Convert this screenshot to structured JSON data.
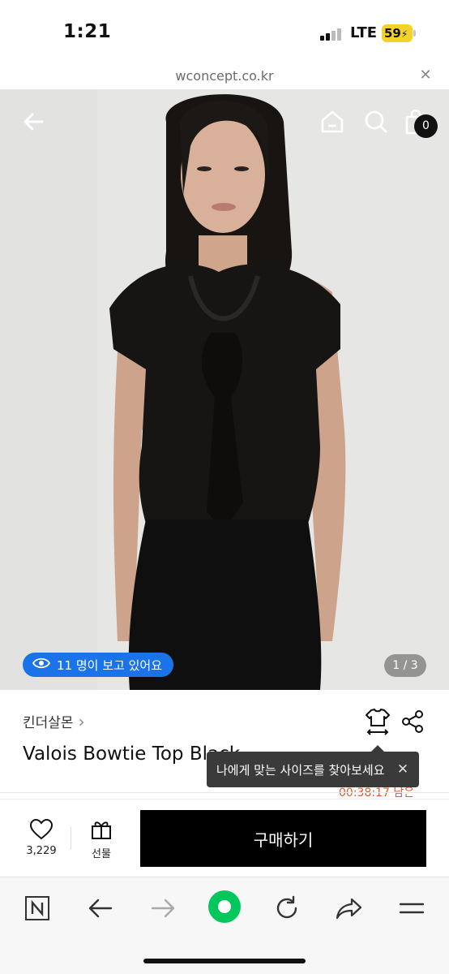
{
  "status_bar": {
    "time": "1:21",
    "network": "LTE",
    "battery": "59",
    "battery_color": "#f4d228"
  },
  "address_bar": {
    "url": "wconcept.co.kr",
    "close_icon": "close-icon"
  },
  "hero": {
    "back_icon": "arrow-left-icon",
    "home_icon": "home-icon",
    "search_icon": "search-icon",
    "bag_icon": "shopping-bag-icon",
    "bag_count": "0",
    "viewers_text": "11 명이 보고 있어요",
    "viewers_icon": "eye-icon",
    "page_indicator": "1 / 3",
    "accent_color": "#1a73e8"
  },
  "product": {
    "brand": "킨더살몬",
    "title": "Valois Bowtie Top Black",
    "timer": "00:38:17 남은",
    "size_tooltip": "나에게 맞는 사이즈를 찾아보세요",
    "timer_color": "#e05a2b"
  },
  "purchase_bar": {
    "like_count": "3,229",
    "gift_label": "선물",
    "buy_label": "구매하기"
  },
  "browser_toolbar": {
    "items": [
      "naver-n-icon",
      "back-arrow-icon",
      "forward-arrow-icon",
      "green-home-icon",
      "refresh-icon",
      "share-icon",
      "menu-icon"
    ],
    "brand_green": "#03c75a"
  }
}
